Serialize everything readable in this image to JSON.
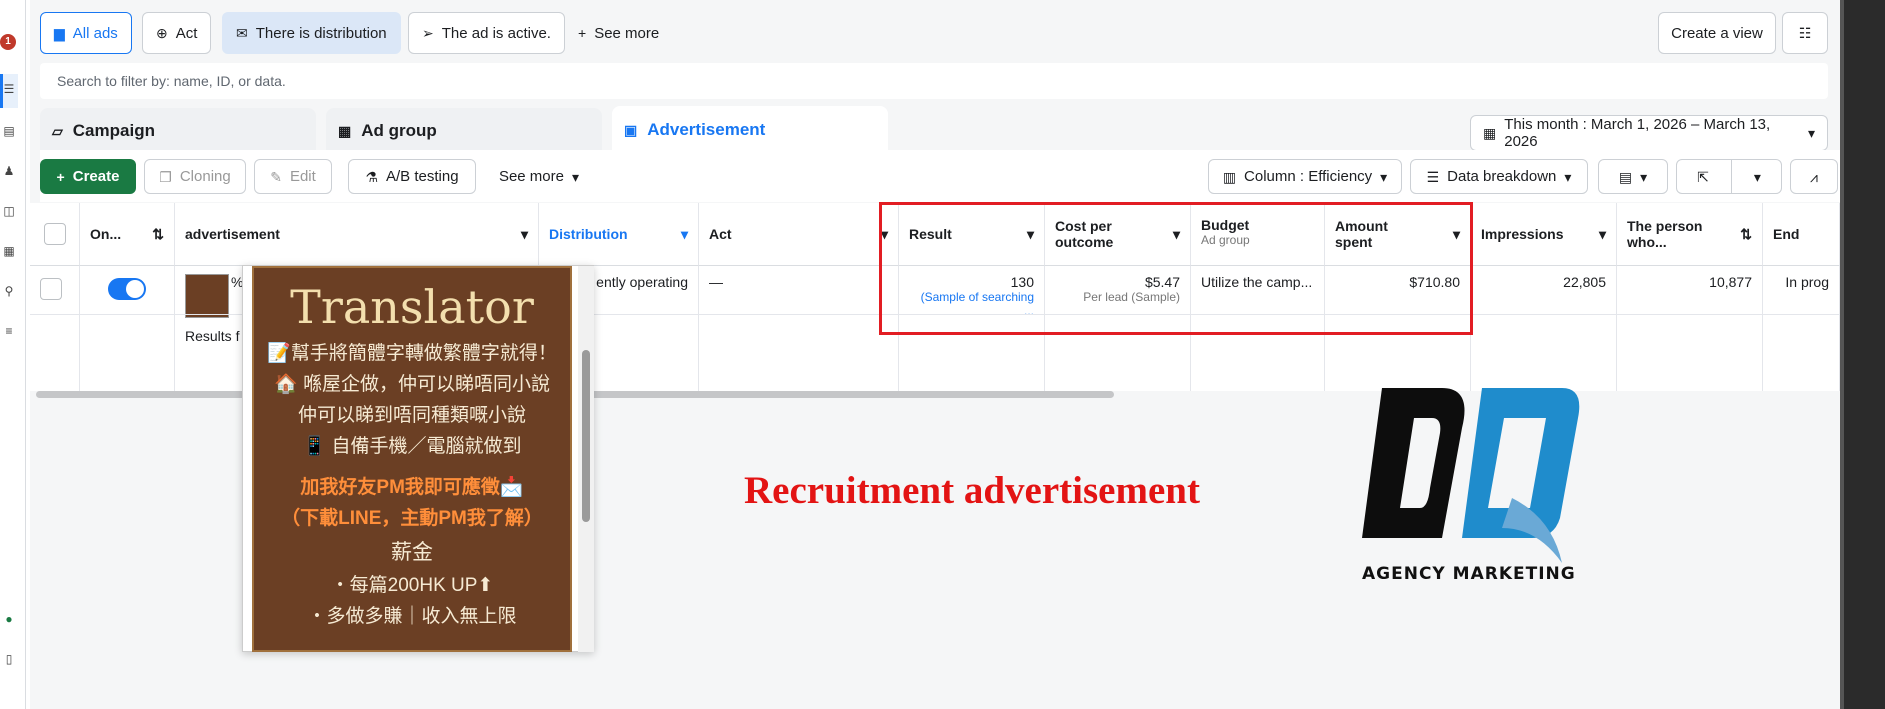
{
  "nav": {
    "badge": "1"
  },
  "filters": {
    "all_ads": "All ads",
    "act": "Act",
    "distribution": "There is distribution",
    "active": "The ad is active.",
    "see_more": "See more",
    "create_view": "Create a view"
  },
  "search": {
    "placeholder": "Search to filter by: name, ID, or data."
  },
  "tabs": {
    "campaign": "Campaign",
    "ad_group": "Ad group",
    "advertisement": "Advertisement"
  },
  "date_range": "This month : March 1, 2026 – March 13, 2026",
  "toolbar": {
    "create": "Create",
    "cloning": "Cloning",
    "edit": "Edit",
    "ab_testing": "A/B testing",
    "see_more": "See more",
    "columns": "Column : Efficiency",
    "breakdown": "Data breakdown"
  },
  "columns": {
    "onoff": "On...",
    "advertisement": "advertisement",
    "distribution": "Distribution",
    "act": "Act",
    "result": "Result",
    "cost_per_outcome": "Cost per outcome",
    "budget": "Budget",
    "budget_sub": "Ad group",
    "amount_spent": "Amount spent",
    "impressions": "Impressions",
    "person": "The person who...",
    "end": "End"
  },
  "row": {
    "ad_initial": "%",
    "distribution": "ently operating",
    "act": "—",
    "result": "130",
    "result_sub": "(Sample of searching ...",
    "cost": "$5.47",
    "cost_sub": "Per lead (Sample)",
    "budget": "Utilize the camp...",
    "amount_spent": "$710.80",
    "impressions": "22,805",
    "person": "10,877",
    "end": "In prog"
  },
  "results_label": "Results f",
  "poster": {
    "title": "Translator",
    "lines": [
      "📝幫手將簡體字轉做繁體字就得！",
      "🏠 喺屋企做，仲可以睇唔同小說",
      "仲可以睇到唔同種類嘅小說",
      "📱 自備手機／電腦就做到"
    ],
    "orange_lines": [
      "加我好友PM我即可應徵📩",
      "（下載LINE，主動PM我了解）"
    ],
    "salary_title": "薪金",
    "salary_lines": [
      "・每篇200HK UP⬆",
      "・多做多賺｜收入無上限"
    ]
  },
  "overlay_caption": "Recruitment advertisement",
  "logo": {
    "text": "AGENCY MARKETING",
    "letters": "DQ"
  },
  "colors": {
    "accent": "#1877f2",
    "create": "#1a7a43",
    "highlight": "#e21d23"
  }
}
